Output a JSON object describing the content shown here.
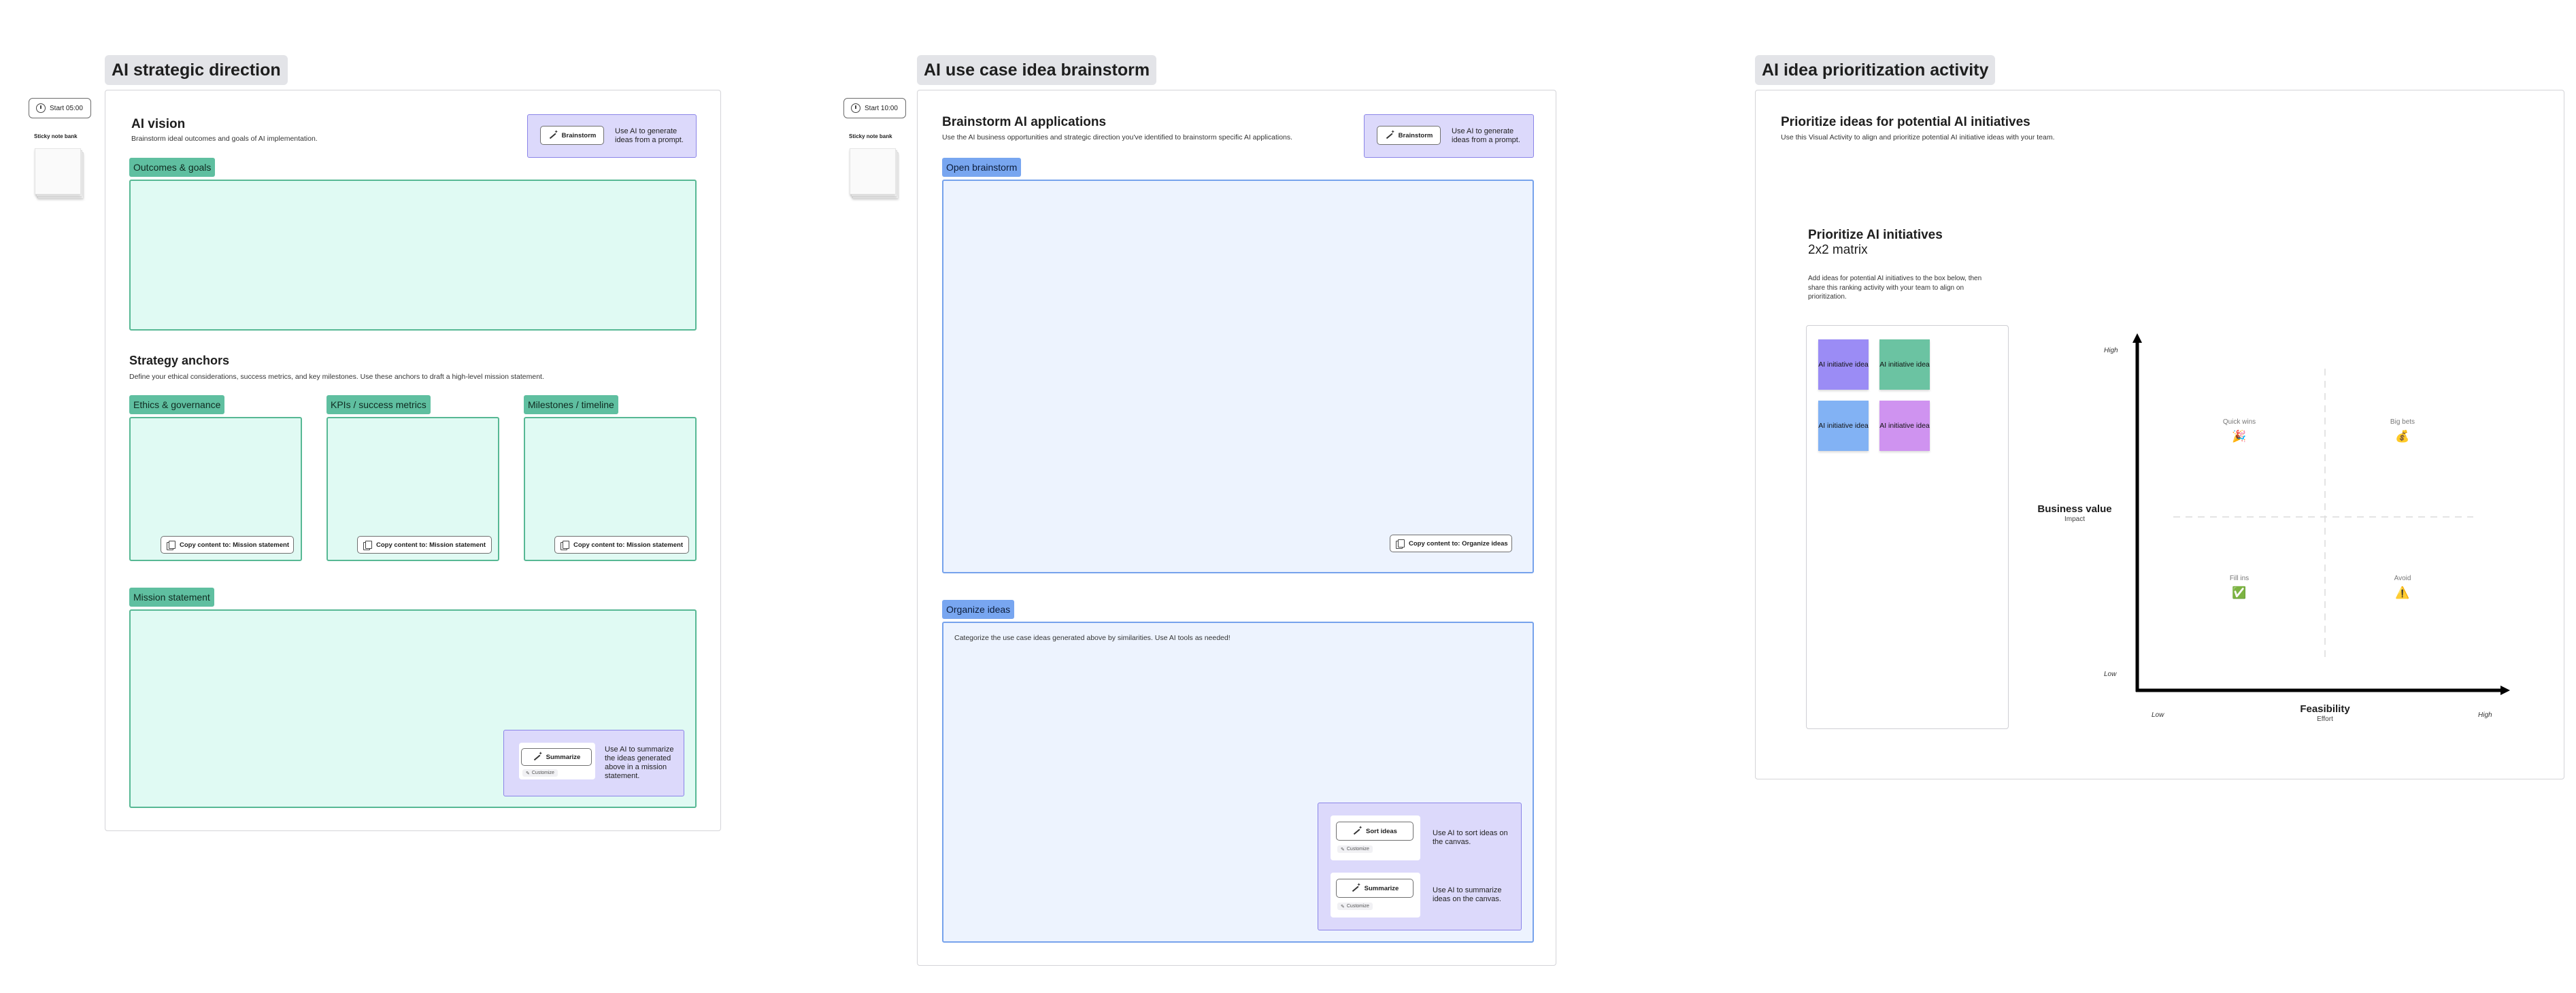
{
  "sections": {
    "s1": {
      "title": "AI strategic direction",
      "timer": "Start 05:00",
      "bank_label": "Sticky note bank",
      "vision": {
        "heading": "AI vision",
        "desc": "Brainstorm ideal outcomes and goals of AI implementation.",
        "ai_button": "Brainstorm",
        "ai_text": "Use AI to generate ideas from a prompt."
      },
      "outcomes_tag": "Outcomes & goals",
      "anchors": {
        "heading": "Strategy anchors",
        "desc": "Define your ethical considerations, success metrics, and key milestones. Use these anchors to draft a high-level mission statement.",
        "items": [
          {
            "tag": "Ethics & governance",
            "copy": "Copy content to: Mission statement"
          },
          {
            "tag": "KPIs / success metrics",
            "copy": "Copy content to: Mission statement"
          },
          {
            "tag": "Milestones / timeline",
            "copy": "Copy content to: Mission statement"
          }
        ]
      },
      "mission": {
        "tag": "Mission statement",
        "ai_button": "Summarize",
        "customize": "Customize",
        "ai_text": "Use AI to summarize the ideas generated above in a mission statement."
      }
    },
    "s2": {
      "title": "AI use case idea brainstorm",
      "timer": "Start 10:00",
      "bank_label": "Sticky note bank",
      "heading": "Brainstorm AI applications",
      "desc": "Use the AI business opportunities and strategic direction you've identified to brainstorm specific AI applications.",
      "ai_button": "Brainstorm",
      "ai_text": "Use AI to generate ideas from a prompt.",
      "open_tag": "Open brainstorm",
      "copy": "Copy content to: Organize ideas",
      "organize": {
        "tag": "Organize ideas",
        "desc": "Categorize the use case ideas generated above by similarities. Use AI tools as needed!",
        "sort_button": "Sort ideas",
        "sort_text": "Use AI to sort ideas on the canvas.",
        "summarize_button": "Summarize",
        "summarize_text": "Use AI to summarize ideas on the canvas.",
        "customize": "Customize"
      }
    },
    "s3": {
      "title": "AI idea prioritization activity",
      "heading": "Prioritize ideas for potential AI initiatives",
      "desc": "Use this Visual Activity to align and prioritize potential AI initiative ideas with your team.",
      "matrix_title": "Prioritize AI initiatives",
      "matrix_subtitle": "2x2 matrix",
      "matrix_desc": "Add ideas for potential AI initiatives to the box below, then share this ranking activity with your team to align on prioritization.",
      "ideas": [
        {
          "label": "AI initiative idea",
          "color": "#9b8cf5"
        },
        {
          "label": "AI initiative idea",
          "color": "#6bc3a2"
        },
        {
          "label": "AI initiative idea",
          "color": "#82b2f4"
        },
        {
          "label": "AI initiative idea",
          "color": "#cf93f0"
        }
      ],
      "y_axis": {
        "high": "High",
        "low": "Low",
        "title": "Business value",
        "subtitle": "Impact"
      },
      "x_axis": {
        "low": "Low",
        "high": "High",
        "title": "Feasibility",
        "subtitle": "Effort"
      },
      "quadrants": [
        {
          "label": "Quick wins",
          "icon": "🎉"
        },
        {
          "label": "Big bets",
          "icon": "💰"
        },
        {
          "label": "Fill ins",
          "icon": "✅"
        },
        {
          "label": "Avoid",
          "icon": "⚠️"
        }
      ]
    }
  }
}
